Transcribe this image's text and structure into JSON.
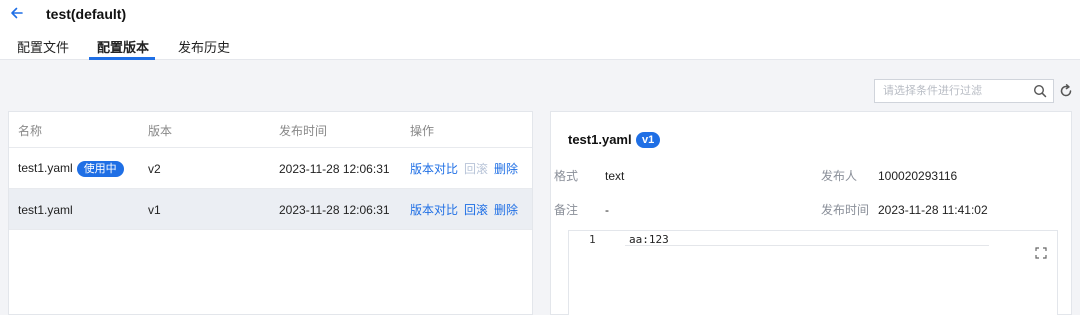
{
  "header": {
    "title": "test(default)"
  },
  "tabs": [
    {
      "label": "配置文件",
      "active": false
    },
    {
      "label": "配置版本",
      "active": true
    },
    {
      "label": "发布历史",
      "active": false
    }
  ],
  "filter": {
    "placeholder": "请选择条件进行过滤"
  },
  "table": {
    "columns": [
      "名称",
      "版本",
      "发布时间",
      "操作"
    ],
    "rows": [
      {
        "name": "test1.yaml",
        "badge": "使用中",
        "version": "v2",
        "time": "2023-11-28 12:06:31",
        "ops": [
          "版本对比",
          "回滚",
          "删除"
        ]
      },
      {
        "name": "test1.yaml",
        "badge": "",
        "version": "v1",
        "time": "2023-11-28 12:06:31",
        "ops": [
          "版本对比",
          "回滚",
          "删除"
        ]
      }
    ]
  },
  "detail": {
    "title": "test1.yaml",
    "version_badge": "v1",
    "format_label": "格式",
    "format_value": "text",
    "publisher_label": "发布人",
    "publisher_value": "100020293116",
    "remark_label": "备注",
    "remark_value": "-",
    "publish_time_label": "发布时间",
    "publish_time_value": "2023-11-28 11:41:02",
    "code_lines": [
      {
        "no": "1",
        "text": "aa:123"
      }
    ]
  },
  "colors": {
    "accent": "#1f6fe5",
    "disabled_link": "#b8c4d8",
    "selected_row": "#ebeef3"
  }
}
